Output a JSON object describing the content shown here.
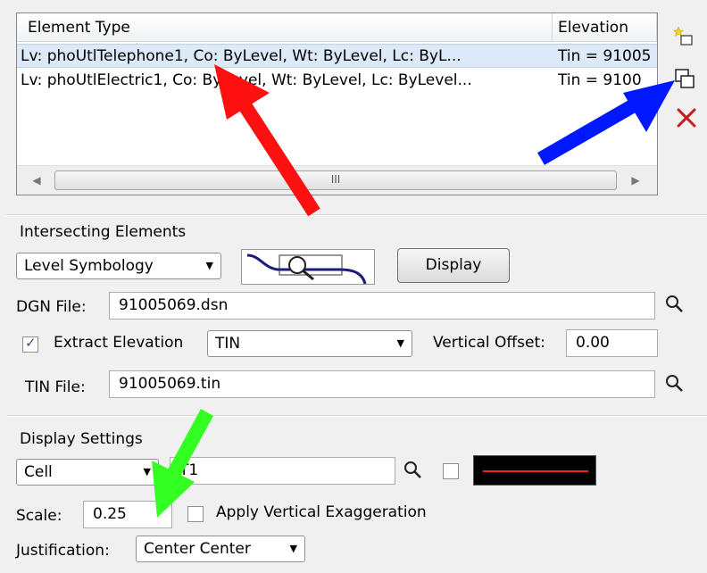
{
  "list": {
    "columns": [
      "Element Type",
      "Elevation"
    ],
    "rows": [
      {
        "type": "Lv: phoUtlTelephone1, Co: ByLevel, Wt: ByLevel, Lc: ByL...",
        "elevation": "Tin = 91005"
      },
      {
        "type": "Lv: phoUtlElectric1, Co: ByLevel, Wt: ByLevel, Lc: ByLevel...",
        "elevation": "Tin = 9100"
      }
    ],
    "scroll_grip": "III"
  },
  "intersecting": {
    "heading": "Intersecting Elements",
    "mode": "Level Symbology",
    "display_label": "Display",
    "dgn_label": "DGN File:",
    "dgn_value": "91005069.dsn",
    "extract_label": "Extract Elevation",
    "extract_checked": true,
    "extract_mode": "TIN",
    "voffset_label": "Vertical Offset:",
    "voffset_value": "0.00",
    "tin_label": "TIN File:",
    "tin_value": "91005069.tin"
  },
  "display": {
    "heading": "Display Settings",
    "type": "Cell",
    "cell_value": "T1",
    "scale_label": "Scale:",
    "scale_value": "0.25",
    "exaggeration_label": "Apply Vertical Exaggeration",
    "exaggeration_checked": false,
    "justification_label": "Justification:",
    "justification_value": "Center Center",
    "swatch_color": "#ff2020"
  },
  "colors": {
    "arrow_red": "#ff1010",
    "arrow_blue": "#0018ff",
    "arrow_green": "#33ff22",
    "delete_red": "#c81c1c",
    "star_yellow": "#f2d21a"
  }
}
